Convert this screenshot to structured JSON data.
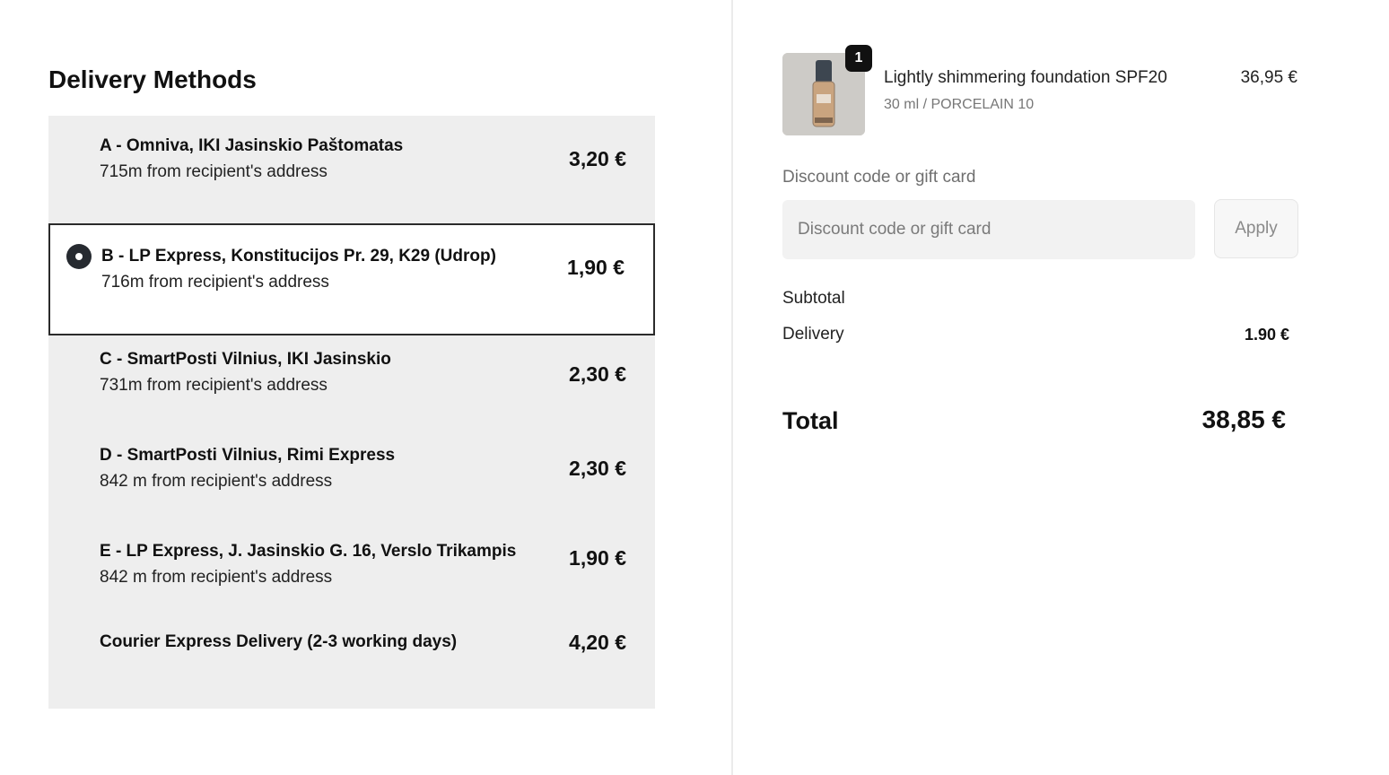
{
  "delivery": {
    "title": "Delivery Methods",
    "selected_index": 1,
    "options": [
      {
        "name": "A - Omniva, IKI Jasinskio Paštomatas",
        "distance": "715m from recipient's address",
        "price": "3,20 €"
      },
      {
        "name": "B - LP Express, Konstitucijos Pr. 29, K29 (Udrop)",
        "distance": "716m from recipient's address",
        "price": "1,90 €"
      },
      {
        "name": "C - SmartPosti Vilnius, IKI Jasinskio",
        "distance": "731m from recipient's address",
        "price": "2,30 €"
      },
      {
        "name": "D - SmartPosti Vilnius, Rimi Express",
        "distance": "842 m from recipient's address",
        "price": "2,30 €"
      },
      {
        "name": "E - LP Express, J. Jasinskio G. 16, Verslo Trikampis",
        "distance": "842 m from recipient's address",
        "price": "1,90 €"
      },
      {
        "name": "Courier Express Delivery (2-3 working days)",
        "distance": "",
        "price": "4,20 €"
      }
    ]
  },
  "cart": {
    "product": {
      "name": "Lightly shimmering foundation SPF20",
      "variant": "30 ml / PORCELAIN 10",
      "price": "36,95 €",
      "quantity": "1"
    },
    "discount": {
      "label": "Discount code or gift card",
      "placeholder": "Discount code or gift card",
      "value": "",
      "apply_label": "Apply"
    },
    "summary": {
      "subtotal_label": "Subtotal",
      "subtotal_value": "",
      "delivery_label": "Delivery",
      "delivery_value": "1.90 €",
      "total_label": "Total",
      "total_value": "38,85 €"
    }
  },
  "colors": {
    "selected_border": "#2b2b2b",
    "option_background": "#eeeeee",
    "radio_fill": "#262a30"
  }
}
